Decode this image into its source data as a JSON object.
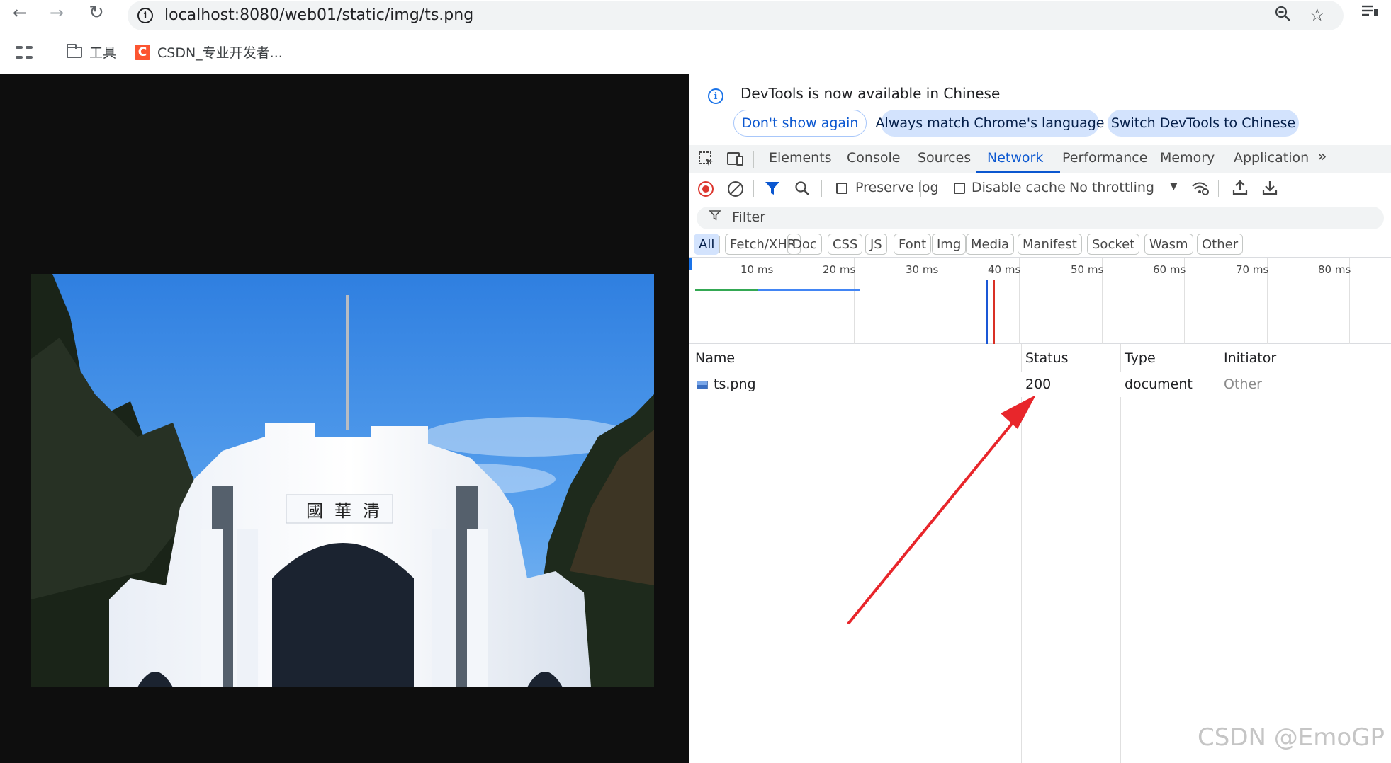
{
  "browser": {
    "url": "localhost:8080/web01/static/img/ts.png",
    "bookmarks": [
      {
        "label": "工具"
      },
      {
        "label": "CSDN_专业开发者..."
      }
    ]
  },
  "devtools": {
    "infobar": {
      "message": "DevTools is now available in Chinese",
      "buttons": [
        "Don't show again",
        "Always match Chrome's language",
        "Switch DevTools to Chinese"
      ]
    },
    "tabs": [
      "Elements",
      "Console",
      "Sources",
      "Network",
      "Performance",
      "Memory",
      "Application"
    ],
    "active_tab": "Network",
    "network_toolbar": {
      "preserve_log": "Preserve log",
      "disable_cache": "Disable cache",
      "throttling": "No throttling"
    },
    "filter_placeholder": "Filter",
    "type_filters": [
      "All",
      "Fetch/XHR",
      "Doc",
      "CSS",
      "JS",
      "Font",
      "Img",
      "Media",
      "Manifest",
      "Socket",
      "Wasm",
      "Other"
    ],
    "active_type_filter": "All",
    "timeline_ticks": [
      "10 ms",
      "20 ms",
      "30 ms",
      "40 ms",
      "50 ms",
      "60 ms",
      "70 ms",
      "80 ms"
    ],
    "columns": [
      "Name",
      "Status",
      "Type",
      "Initiator"
    ],
    "requests": [
      {
        "name": "ts.png",
        "status": "200",
        "type": "document",
        "initiator": "Other"
      }
    ]
  },
  "watermark": "CSDN @EmoGP",
  "colors": {
    "accent": "#0b57d0",
    "record_red": "#dc362e",
    "arrow_red": "#e8262b"
  }
}
